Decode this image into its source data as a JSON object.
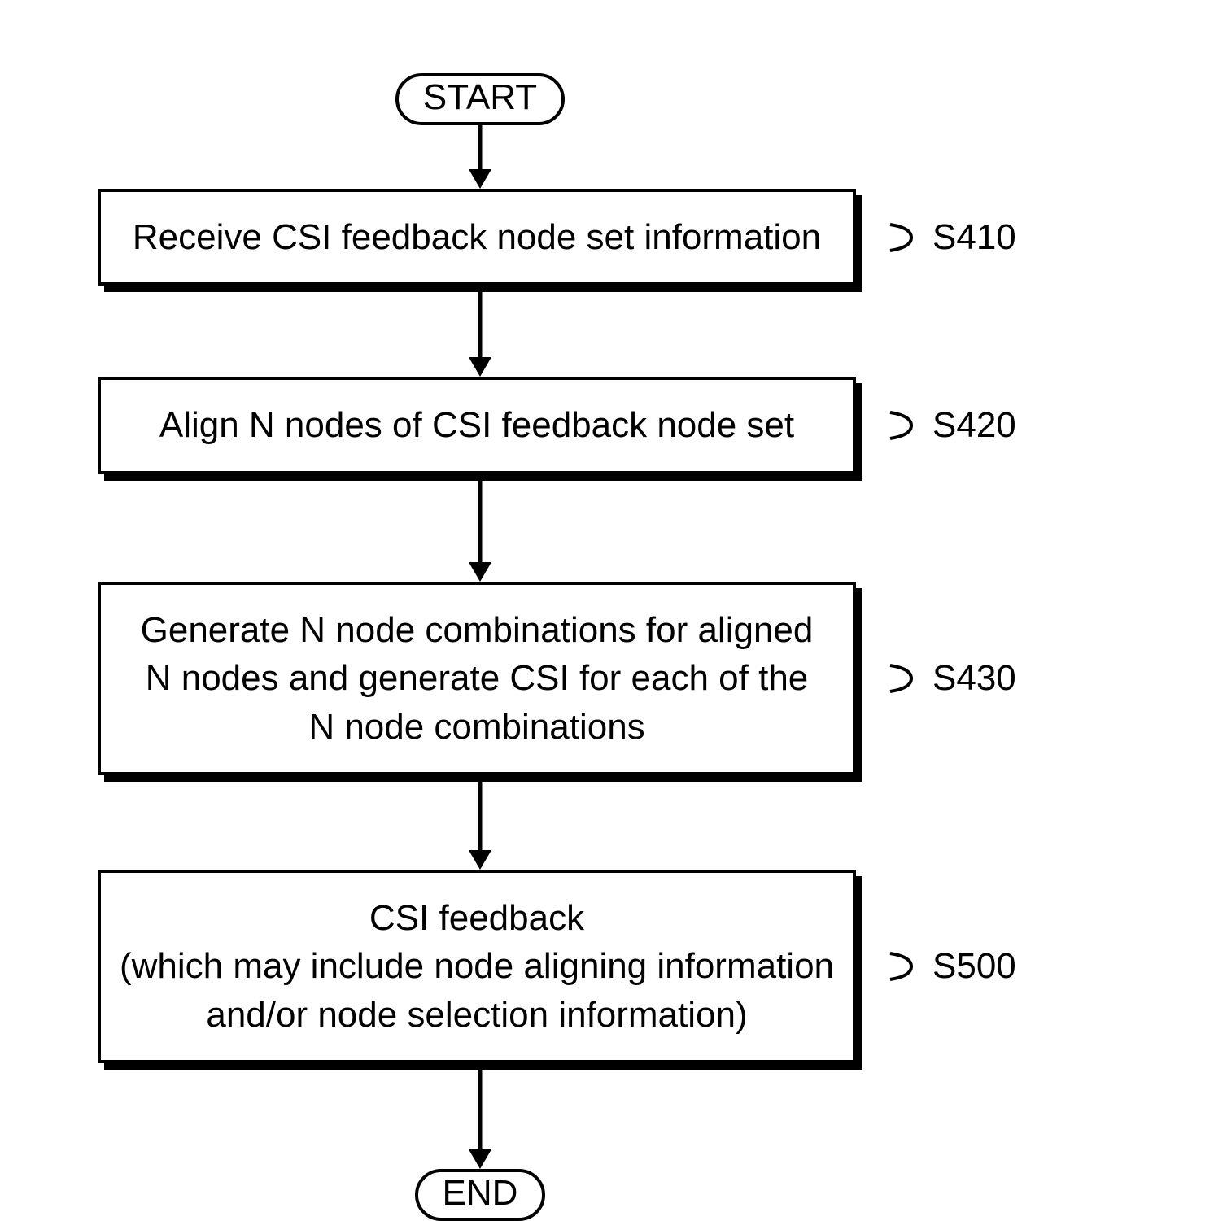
{
  "flowchart": {
    "start": "START",
    "end": "END",
    "steps": [
      {
        "text": "Receive CSI feedback node set information",
        "label": "S410"
      },
      {
        "text": "Align N nodes of CSI feedback node set",
        "label": "S420"
      },
      {
        "text": "Generate N node combinations for aligned\nN nodes and generate CSI for each of the\nN node combinations",
        "label": "S430"
      },
      {
        "text": "CSI feedback\n(which may include node aligning information\nand/or node selection information)",
        "label": "S500"
      }
    ]
  }
}
